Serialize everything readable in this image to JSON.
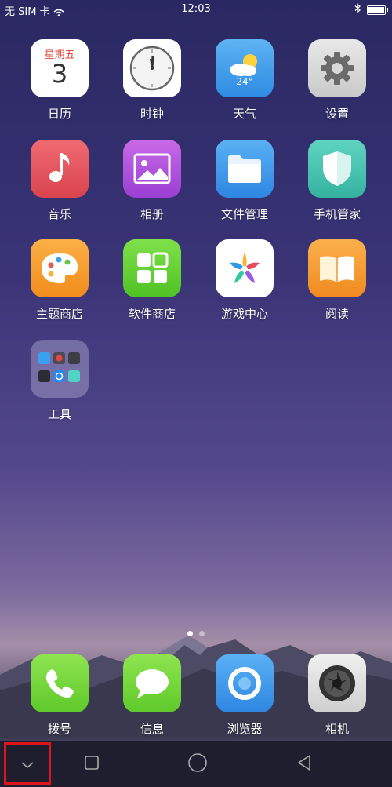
{
  "status": {
    "carrier": "无 SIM 卡",
    "time": "12:03"
  },
  "apps": {
    "calendar": {
      "label": "日历",
      "weekday": "星期五",
      "day": "3"
    },
    "clock": {
      "label": "时钟"
    },
    "weather": {
      "label": "天气",
      "temp": "24°"
    },
    "settings": {
      "label": "设置"
    },
    "music": {
      "label": "音乐"
    },
    "gallery": {
      "label": "相册"
    },
    "files": {
      "label": "文件管理"
    },
    "security": {
      "label": "手机管家"
    },
    "theme": {
      "label": "主题商店"
    },
    "appstore": {
      "label": "软件商店"
    },
    "games": {
      "label": "游戏中心"
    },
    "reader": {
      "label": "阅读"
    },
    "tools": {
      "label": "工具"
    }
  },
  "dock": {
    "phone": {
      "label": "拨号"
    },
    "messages": {
      "label": "信息"
    },
    "browser": {
      "label": "浏览器"
    },
    "camera": {
      "label": "相机"
    }
  },
  "pages": {
    "count": 2,
    "current": 1
  },
  "colors": {
    "highlight": "#e0141d"
  }
}
